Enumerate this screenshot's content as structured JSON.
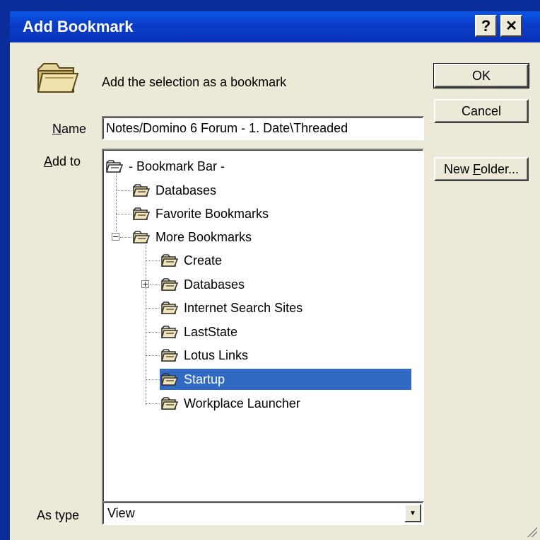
{
  "window": {
    "title": "Add Bookmark",
    "help_label": "?",
    "close_label": "✕"
  },
  "header": {
    "description": "Add the selection as a bookmark",
    "icon": "folder-icon"
  },
  "buttons": {
    "ok": "OK",
    "cancel": "Cancel",
    "new_folder_prefix": "New ",
    "new_folder_accel": "F",
    "new_folder_suffix": "older..."
  },
  "name_field": {
    "label_accel": "N",
    "label_rest": "ame",
    "value": "Notes/Domino 6 Forum - 1. Date\\Threaded"
  },
  "add_to": {
    "label_accel": "A",
    "label_rest": "dd to"
  },
  "tree": {
    "root": "- Bookmark Bar -",
    "level1": [
      "Databases",
      "Favorite Bookmarks",
      "More Bookmarks"
    ],
    "level2": [
      "Create",
      "Databases",
      "Internet Search Sites",
      "LastState",
      "Lotus Links",
      "Startup",
      "Workplace Launcher"
    ],
    "selected": "Startup",
    "expander_open": "−",
    "expander_closed": "+"
  },
  "as_type": {
    "label": "As type",
    "value": "View",
    "drop_icon": "▼"
  },
  "colors": {
    "title_bar": "#0a3cc7",
    "selection": "#316ac5",
    "dialog_bg": "#ece9d8"
  }
}
